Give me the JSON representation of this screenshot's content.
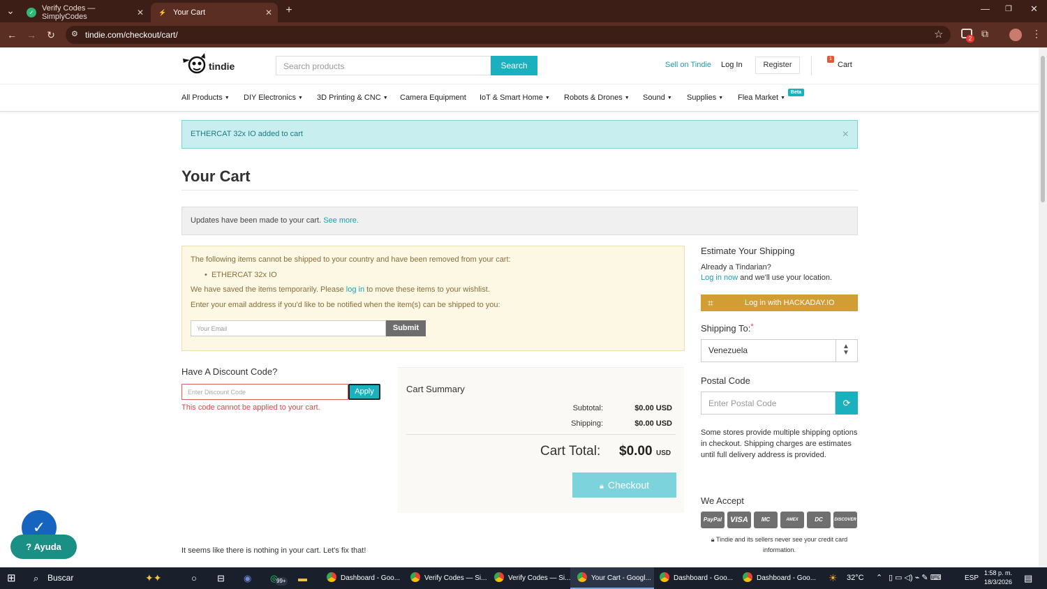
{
  "browser": {
    "tabs": [
      {
        "title": "Verify Codes — SimplyCodes",
        "active": false
      },
      {
        "title": "Your Cart",
        "active": true
      }
    ],
    "url": "tindie.com/checkout/cart/",
    "extension_badge": "2"
  },
  "header": {
    "logo_text": "tindie",
    "search_placeholder": "Search products",
    "search_button": "Search",
    "sell_link": "Sell on Tindie",
    "login_link": "Log In",
    "register_button": "Register",
    "cart_count": "1",
    "cart_label": "Cart"
  },
  "nav": {
    "items": [
      "All Products",
      "DIY Electronics",
      "3D Printing & CNC",
      "Camera Equipment",
      "IoT & Smart Home",
      "Robots & Drones",
      "Sound",
      "Supplies",
      "Flea Market"
    ],
    "beta_badge": "Beta"
  },
  "alert": {
    "text": "ETHERCAT 32x IO added to cart",
    "close": "×"
  },
  "cart": {
    "title": "Your Cart",
    "updates_text": "Updates have been made to your cart.",
    "updates_link": "See more."
  },
  "warning": {
    "line1": "The following items cannot be shipped to your country and have been removed from your cart:",
    "item": "ETHERCAT 32x IO",
    "line2_pre": "We have saved the items temporarily. Please",
    "line2_link": "log in",
    "line2_post": "to move these items to your wishlist.",
    "line3": "Enter your email address if you'd like to be notified when the item(s) can be shipped to you:",
    "email_placeholder": "Your Email",
    "submit": "Submit"
  },
  "discount": {
    "heading": "Have A Discount Code?",
    "placeholder": "Enter Discount Code",
    "apply": "Apply",
    "error": "This code cannot be applied to your cart."
  },
  "summary": {
    "title": "Cart Summary",
    "subtotal_label": "Subtotal:",
    "subtotal_value": "$0.00 USD",
    "shipping_label": "Shipping:",
    "shipping_value": "$0.00 USD",
    "total_label": "Cart Total:",
    "total_value": "$0.00",
    "total_currency": "USD",
    "checkout": "Checkout"
  },
  "shipping": {
    "heading": "Estimate Your Shipping",
    "tindarian": "Already a Tindarian?",
    "login_link": "Log in now",
    "login_post": "and we'll use your location.",
    "hackaday": "Log in with HACKADAY.IO",
    "shipping_to": "Shipping To:",
    "required_mark": "*",
    "country": "Venezuela",
    "postal_heading": "Postal Code",
    "postal_placeholder": "Enter Postal Code",
    "note": "Some stores provide multiple shipping options in checkout. Shipping charges are estimates until full delivery address is provided.",
    "we_accept": "We Accept",
    "cards": [
      "PayPal",
      "VISA",
      "MC",
      "AMEX",
      "DC",
      "DISCOVER"
    ],
    "privacy": "Tindie and its sellers never see your credit card information."
  },
  "empty_msg": "It seems like there is nothing in your cart. Let's fix that!",
  "help": {
    "label": "Ayuda"
  },
  "taskbar": {
    "search": "Buscar",
    "badge": "99+",
    "apps": [
      {
        "title": "Dashboard - Goo...",
        "active": false
      },
      {
        "title": "Verify Codes — Si...",
        "active": false
      },
      {
        "title": "Verify Codes — Si...",
        "active": false
      },
      {
        "title": "Your Cart - Googl...",
        "active": true
      },
      {
        "title": "Dashboard - Goo...",
        "active": false
      },
      {
        "title": "Dashboard - Goo...",
        "active": false
      }
    ],
    "weather": "32°C",
    "lang": "ESP",
    "time": "1:58 p. m.",
    "date": "18/3/2026"
  },
  "colors": {
    "accent": "#1bb0be",
    "chrome_dark": "#3c1e17",
    "chrome_mid": "#5a2e22",
    "error": "#e04646",
    "hackaday": "#d29d32"
  }
}
